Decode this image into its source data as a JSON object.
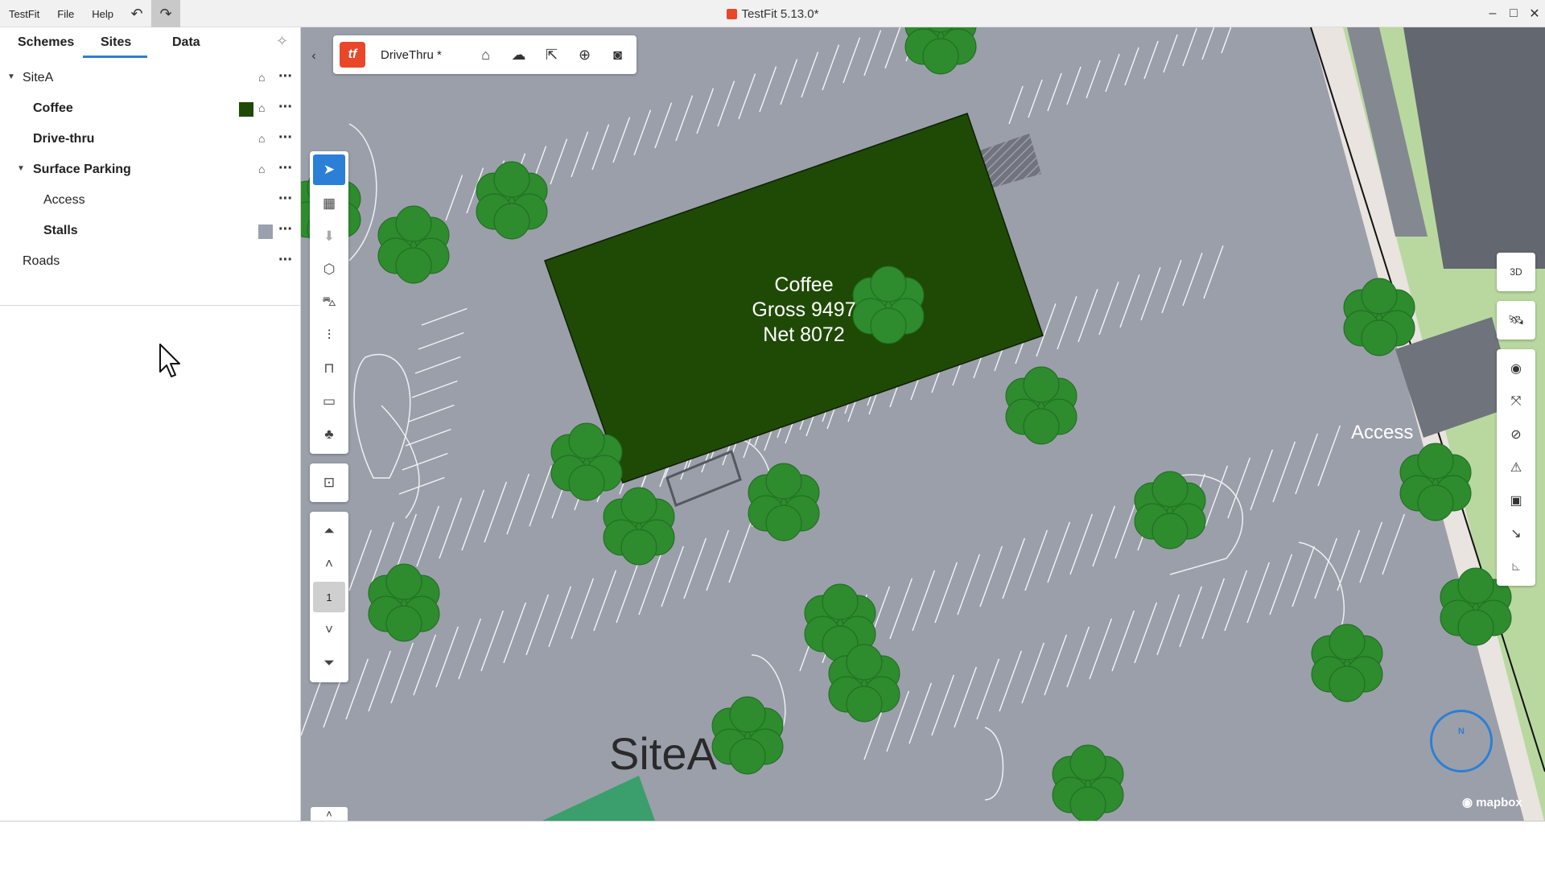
{
  "titlebar": {
    "menu": [
      "TestFit",
      "File",
      "Help"
    ],
    "undo_icon": "undo-icon",
    "redo_icon": "redo-icon",
    "title": "TestFit 5.13.0*",
    "window_controls": [
      "minimize-icon",
      "maximize-icon",
      "close-icon"
    ]
  },
  "leftpanel": {
    "tabs": [
      "Schemes",
      "Sites",
      "Data"
    ],
    "active_tab": "Sites",
    "tree": [
      {
        "label": "SiteA",
        "expanded": true,
        "bold": true
      },
      {
        "label": "Coffee",
        "swatch": "#1f4a05"
      },
      {
        "label": "Drive-thru"
      },
      {
        "label": "Surface Parking",
        "expanded": true
      },
      {
        "label": "Access"
      },
      {
        "label": "Stalls",
        "swatch": "#9aa0ad"
      },
      {
        "label": "Roads"
      }
    ]
  },
  "topcard": {
    "scheme_name": "DriveThru *",
    "logo_text": "tf",
    "icons": [
      "home-icon",
      "cloud-sync-icon",
      "share-icon",
      "add-circle-icon",
      "camera-icon"
    ]
  },
  "vertical_toolbar": {
    "tools": [
      "select-icon",
      "building-icon",
      "stamp-icon",
      "cube-icon",
      "car-icon",
      "parking-add-icon",
      "canopy-icon",
      "ruler-icon",
      "tree-icon"
    ],
    "second": [
      "add-shape-icon"
    ],
    "levels": {
      "current": "1"
    }
  },
  "right_toolbar": {
    "view_3d": "3D",
    "icons": [
      "satellite-icon",
      "eye-icon",
      "fit-view-icon",
      "compass-icon",
      "warning-icon",
      "image-icon",
      "arrow-diagonal-icon",
      "ruler-corner-icon"
    ]
  },
  "map": {
    "building_name": "Coffee",
    "building_gross": "Gross 9497",
    "building_net": "Net 8072",
    "building_color": "#1f4a05",
    "site_label": "SiteA",
    "access_label": "Access",
    "attribution": "mapbox",
    "compass_n": "N"
  }
}
